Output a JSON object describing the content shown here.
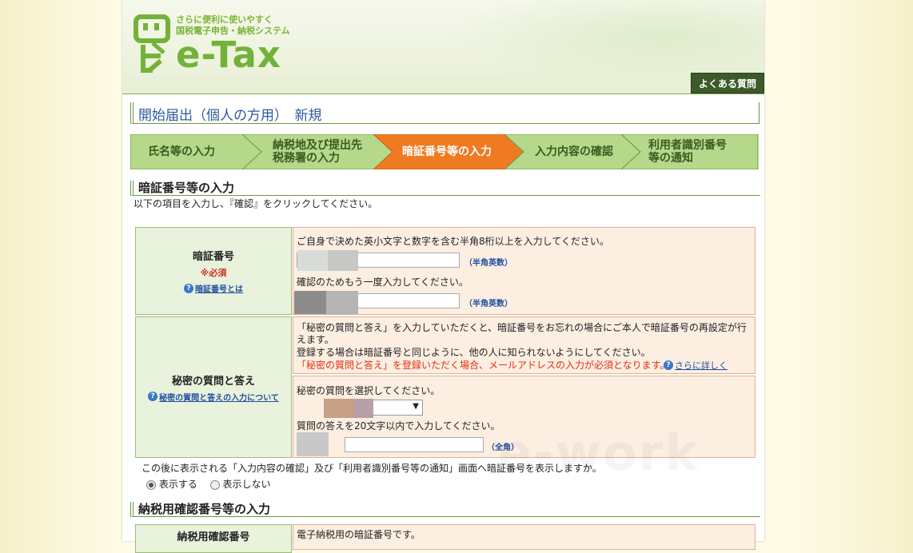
{
  "header": {
    "tagline_line1": "さらに便利に使いやすく",
    "tagline_line2": "国税電子申告・納税システム",
    "logo_text": "e-Tax",
    "faq_label": "よくある質問"
  },
  "page_title": "開始届出（個人の方用）　新規",
  "steps": [
    {
      "label_line1": "氏名等の入力",
      "label_line2": "",
      "active": false
    },
    {
      "label_line1": "納税地及び提出先",
      "label_line2": "税務署の入力",
      "active": false
    },
    {
      "label_line1": "暗証番号等の入力",
      "label_line2": "",
      "active": true
    },
    {
      "label_line1": "入力内容の確認",
      "label_line2": "",
      "active": false
    },
    {
      "label_line1": "利用者識別番号",
      "label_line2": "等の通知",
      "active": false
    }
  ],
  "section1": {
    "title": "暗証番号等の入力",
    "instruction": "以下の項目を入力し、『確認』をクリックしてください。",
    "pin": {
      "header": "暗証番号",
      "required": "※必須",
      "help_link": "暗証番号とは",
      "desc": "ご自身で決めた英小文字と数字を含む半角8桁以上を入力してください。",
      "hint1": "（半角英数）",
      "confirm_desc": "確認のためもう一度入力してください。",
      "hint2": "（半角英数）"
    },
    "secret": {
      "header": "秘密の質問と答え",
      "help_link": "秘密の質問と答えの入力について",
      "info1": "「秘密の質問と答え」を入力していただくと、暗証番号をお忘れの場合にご本人で暗証番号の再設定が行",
      "info1b": "えます。",
      "info2": "登録する場合は暗証番号と同じように、他の人に知られないようにしてください。",
      "info3": "「秘密の質問と答え」を登録いただく場合、メールアドレスの入力が必須となります。",
      "more_link": "さらに詳しく",
      "question_label": "秘密の質問を選択してください。",
      "answer_label": "質問の答えを20文字以内で入力してください。",
      "answer_hint": "（全角）"
    },
    "display_question": "この後に表示される「入力内容の確認」及び「利用者識別番号等の通知」画面へ暗証番号を表示しますか。",
    "radio_show": "表示する",
    "radio_hide": "表示しない",
    "radio_selected": "表示する"
  },
  "section2": {
    "title": "納税用確認番号等の入力",
    "row_header": "納税用確認番号",
    "row_desc": "電子納税用の暗証番号です。"
  },
  "colors": {
    "accent_green": "#74b13a",
    "active_step": "#f07a22",
    "step_green": "#b5d88a"
  }
}
